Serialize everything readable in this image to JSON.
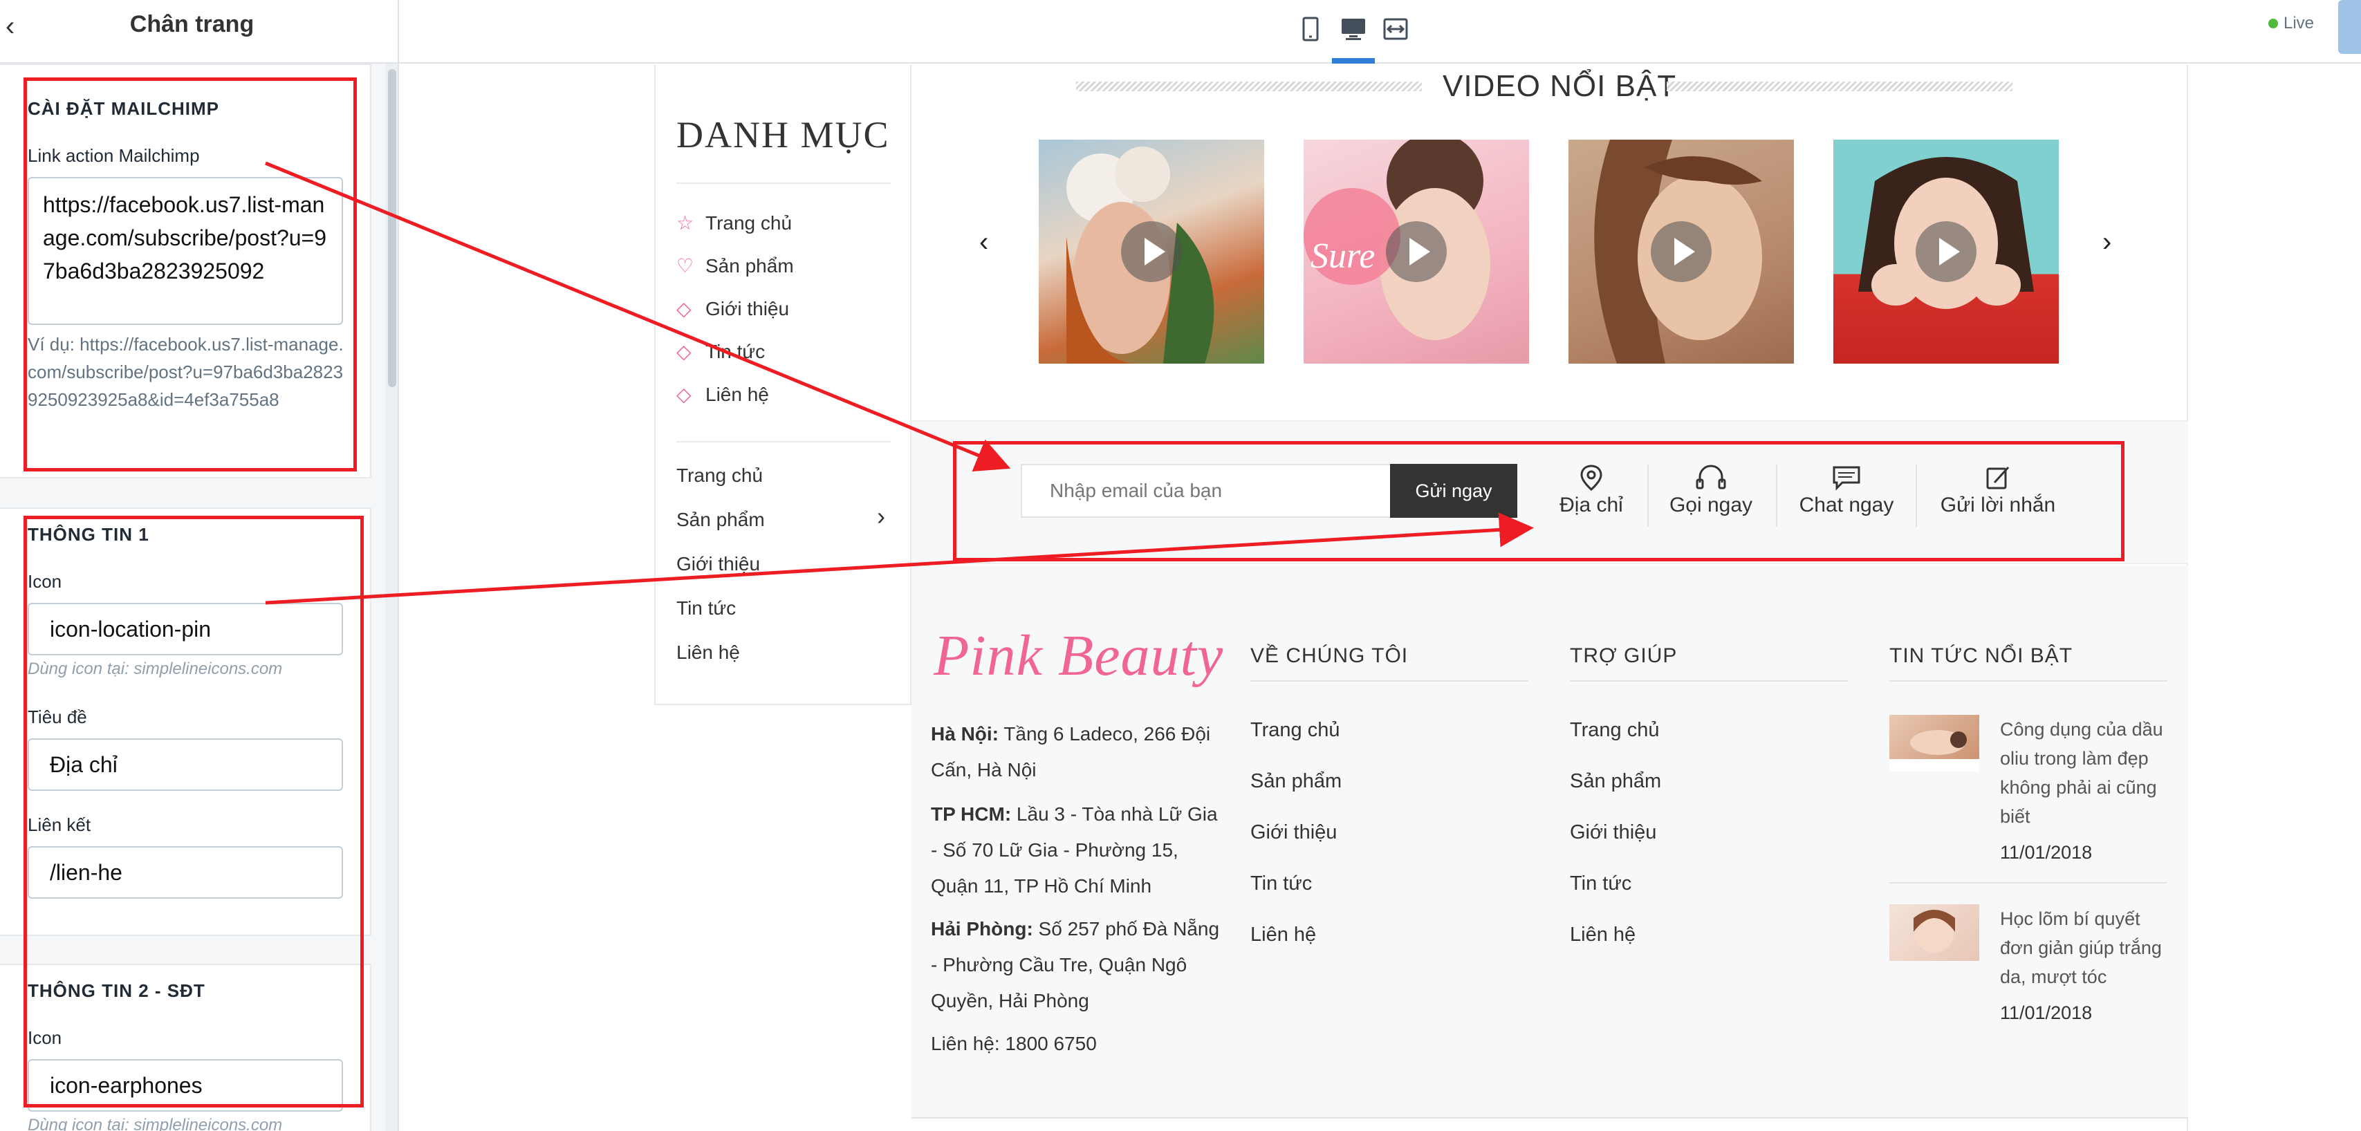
{
  "left_panel": {
    "title": "Chân trang",
    "mailchimp": {
      "title": "CÀI ĐẶT MAILCHIMP",
      "link_label": "Link action Mailchimp",
      "link_value": "https://facebook.us7.list-manage.com/subscribe/post?u=97ba6d3ba2823925092",
      "example": "Ví dụ: https://facebook.us7.list-manage.com/subscribe/post?u=97ba6d3ba28239250923925a8&id=4ef3a755a8"
    },
    "info1": {
      "title": "THÔNG TIN 1",
      "icon_label": "Icon",
      "icon_value": "icon-location-pin",
      "icon_hint": "Dùng icon tại: simplelineicons.com",
      "title_label": "Tiêu đề",
      "title_value": "Địa chỉ",
      "link_label": "Liên kết",
      "link_value": "/lien-he"
    },
    "info2": {
      "title": "THÔNG TIN 2 - SĐT",
      "icon_label": "Icon",
      "icon_value": "icon-earphones",
      "icon_hint": "Dùng icon tại: simplelineicons.com"
    }
  },
  "topbar": {
    "devices": [
      "mobile-icon",
      "desktop-icon",
      "fullwidth-icon"
    ],
    "active_device": "desktop",
    "live": "Live"
  },
  "category": {
    "title": "DANH MỤC",
    "icon_items": [
      {
        "icon": "star-icon",
        "label": "Trang chủ"
      },
      {
        "icon": "heart-icon",
        "label": "Sản phẩm"
      },
      {
        "icon": "tag-icon",
        "label": "Giới thiệu"
      },
      {
        "icon": "diamond-icon",
        "label": "Tin tức"
      },
      {
        "icon": "diamond-icon",
        "label": "Liên hệ"
      }
    ],
    "menu_items": [
      "Trang chủ",
      "Sản phẩm",
      "Giới thiệu",
      "Tin tức",
      "Liên hệ"
    ]
  },
  "video": {
    "title": "VIDEO NỔI BẬT",
    "prev": "‹",
    "next": "›"
  },
  "subscribe": {
    "placeholder": "Nhập email của bạn",
    "button": "Gửi ngay",
    "contacts": [
      {
        "icon": "location-pin-icon",
        "label": "Địa chỉ"
      },
      {
        "icon": "earphones-icon",
        "label": "Gọi ngay"
      },
      {
        "icon": "chat-icon",
        "label": "Chat ngay"
      },
      {
        "icon": "edit-icon",
        "label": "Gửi lời nhắn"
      }
    ]
  },
  "footer": {
    "brand": "Pink Beauty",
    "addresses": [
      {
        "label": "Hà Nội:",
        "text": " Tầng 6 Ladeco, 266 Đội Cấn, Hà Nội"
      },
      {
        "label": "TP HCM:",
        "text": " Lầu 3 - Tòa nhà Lữ Gia - Số 70 Lữ Gia - Phường 15, Quận 11, TP Hồ Chí Minh"
      },
      {
        "label": "Hải Phòng:",
        "text": " Số 257 phố Đà Nẵng - Phường Cầu Tre, Quận Ngô Quyền, Hải Phòng"
      }
    ],
    "hotline": "Liên hệ: 1800 6750",
    "about": {
      "title": "VỀ CHÚNG TÔI",
      "links": [
        "Trang chủ",
        "Sản phẩm",
        "Giới thiệu",
        "Tin tức",
        "Liên hệ"
      ]
    },
    "help": {
      "title": "TRỢ GIÚP",
      "links": [
        "Trang chủ",
        "Sản phẩm",
        "Giới thiệu",
        "Tin tức",
        "Liên hệ"
      ]
    },
    "news": {
      "title": "TIN TỨC NỔI BẬT",
      "items": [
        {
          "title": "Công dụng của dầu oliu trong làm đẹp không phải ai cũng biết",
          "date": "11/01/2018"
        },
        {
          "title": "Học lõm bí quyết đơn giản giúp trắng da, mượt tóc",
          "date": "11/01/2018"
        }
      ]
    }
  },
  "colors": {
    "accent_pink": "#f06595",
    "annotation_red": "#ee1d23",
    "active_blue": "#2f7ed8",
    "live_green": "#50b83c"
  }
}
